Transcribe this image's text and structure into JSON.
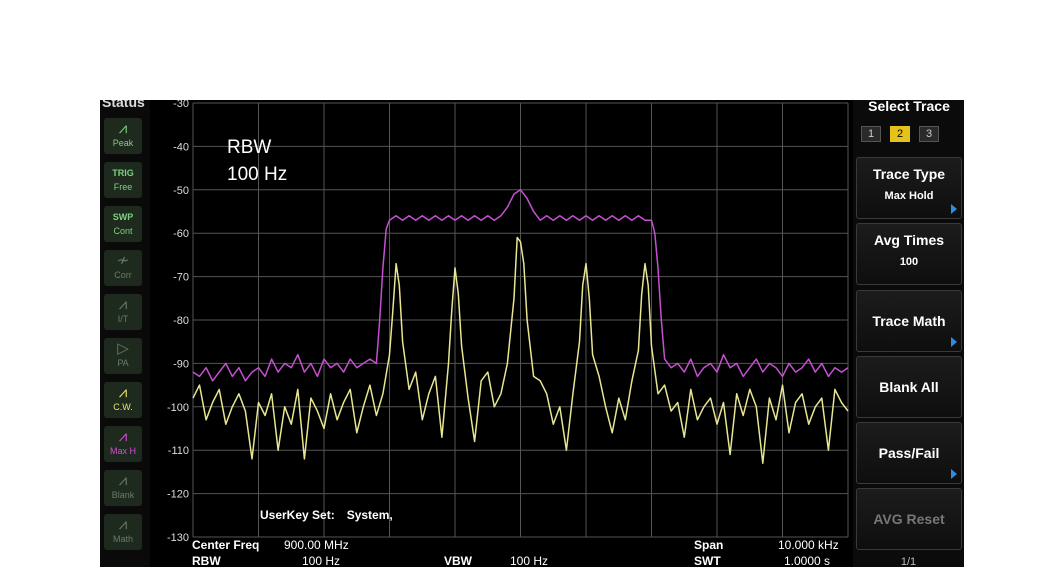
{
  "status_panel": {
    "title": "Status",
    "buttons": [
      {
        "label": "Peak",
        "icon": "peak-icon",
        "color": "#7fcf7f",
        "dim": false
      },
      {
        "label_top": "TRIG",
        "label": "Free",
        "icon": "trigger-icon",
        "color": "#7fcf7f",
        "dim": false
      },
      {
        "label_top": "SWP",
        "label": "Cont",
        "icon": "sweep-icon",
        "color": "#7fcf7f",
        "dim": false
      },
      {
        "label": "Corr",
        "icon": "correction-icon",
        "color": "#6a7a6a",
        "dim": true
      },
      {
        "label": "I/T",
        "icon": "impedance-icon",
        "color": "#6a7a6a",
        "dim": true
      },
      {
        "label": "PA",
        "icon": "preamp-icon",
        "color": "#6a7a6a",
        "dim": true
      },
      {
        "label": "C.W.",
        "icon": "clear-write-icon",
        "color": "#e8e46a",
        "dim": false
      },
      {
        "label": "Max H",
        "icon": "max-hold-icon",
        "color": "#d04fd4",
        "dim": false
      },
      {
        "label": "Blank",
        "icon": "blank-icon",
        "color": "#6a7a6a",
        "dim": true
      },
      {
        "label": "Math",
        "icon": "math-icon",
        "color": "#6a7a6a",
        "dim": true
      }
    ]
  },
  "annotation": {
    "line1": "RBW",
    "line2": "100 Hz"
  },
  "userkey": {
    "label": "UserKey Set:",
    "value": "System,"
  },
  "footer": {
    "center_freq_label": "Center Freq",
    "center_freq_value": "900.00 MHz",
    "span_label": "Span",
    "span_value": "10.000 kHz",
    "rbw_label": "RBW",
    "rbw_value": "100 Hz",
    "vbw_label": "VBW",
    "vbw_value": "100 Hz",
    "swt_label": "SWT",
    "swt_value": "1.0000 s"
  },
  "menu": {
    "title": "Select Trace",
    "traces": [
      "1",
      "2",
      "3"
    ],
    "active_trace": "2",
    "trace_type_label": "Trace Type",
    "trace_type_value": "Max Hold",
    "avg_times_label": "Avg Times",
    "avg_times_value": "100",
    "trace_math_label": "Trace Math",
    "blank_all_label": "Blank All",
    "pass_fail_label": "Pass/Fail",
    "avg_reset_label": "AVG Reset",
    "page_indicator": "1/1"
  },
  "chart_data": {
    "type": "line",
    "x_unit": "kHz offset from 900.00 MHz",
    "xlim": [
      -5,
      5
    ],
    "ylim": [
      -130,
      -30
    ],
    "y_ticks": [
      "-30",
      "-40",
      "-50",
      "-60",
      "-70",
      "-80",
      "-90",
      "-100",
      "-110",
      "-120",
      "-130"
    ],
    "grid": true,
    "series": [
      {
        "color": "#e8e690",
        "x": [
          -5.0,
          -4.9,
          -4.8,
          -4.7,
          -4.6,
          -4.5,
          -4.4,
          -4.3,
          -4.2,
          -4.1,
          -4.0,
          -3.9,
          -3.8,
          -3.7,
          -3.6,
          -3.5,
          -3.4,
          -3.3,
          -3.2,
          -3.1,
          -3.0,
          -2.9,
          -2.8,
          -2.7,
          -2.6,
          -2.5,
          -2.4,
          -2.3,
          -2.2,
          -2.1,
          -2.0,
          -1.95,
          -1.9,
          -1.85,
          -1.8,
          -1.7,
          -1.6,
          -1.5,
          -1.4,
          -1.3,
          -1.2,
          -1.1,
          -1.05,
          -1.0,
          -0.95,
          -0.9,
          -0.8,
          -0.7,
          -0.6,
          -0.5,
          -0.4,
          -0.3,
          -0.2,
          -0.1,
          -0.05,
          0.0,
          0.05,
          0.1,
          0.2,
          0.3,
          0.4,
          0.5,
          0.6,
          0.7,
          0.8,
          0.9,
          0.95,
          1.0,
          1.05,
          1.1,
          1.2,
          1.3,
          1.4,
          1.5,
          1.6,
          1.7,
          1.8,
          1.85,
          1.9,
          1.95,
          2.0,
          2.1,
          2.2,
          2.3,
          2.4,
          2.5,
          2.6,
          2.7,
          2.8,
          2.9,
          3.0,
          3.1,
          3.2,
          3.3,
          3.4,
          3.5,
          3.6,
          3.7,
          3.8,
          3.9,
          4.0,
          4.1,
          4.2,
          4.3,
          4.4,
          4.5,
          4.6,
          4.7,
          4.8,
          4.9,
          5.0
        ],
        "y": [
          -98,
          -95,
          -103,
          -99,
          -96,
          -104,
          -100,
          -97,
          -101,
          -112,
          -99,
          -102,
          -97,
          -110,
          -100,
          -104,
          -96,
          -112,
          -98,
          -101,
          -105,
          -97,
          -103,
          -99,
          -96,
          -106,
          -100,
          -95,
          -102,
          -97,
          -88,
          -78,
          -67,
          -72,
          -85,
          -96,
          -92,
          -103,
          -97,
          -93,
          -107,
          -90,
          -78,
          -68,
          -74,
          -86,
          -98,
          -108,
          -94,
          -92,
          -100,
          -97,
          -90,
          -75,
          -61,
          -62,
          -67,
          -80,
          -93,
          -94,
          -97,
          -104,
          -100,
          -110,
          -97,
          -85,
          -72,
          -67,
          -75,
          -88,
          -93,
          -100,
          -106,
          -98,
          -103,
          -94,
          -87,
          -74,
          -67,
          -72,
          -86,
          -97,
          -95,
          -101,
          -99,
          -107,
          -96,
          -103,
          -100,
          -98,
          -104,
          -99,
          -111,
          -97,
          -102,
          -96,
          -100,
          -113,
          -98,
          -103,
          -95,
          -106,
          -99,
          -97,
          -104,
          -100,
          -98,
          -110,
          -96,
          -99,
          -101
        ]
      },
      {
        "color": "#c551d1",
        "x": [
          -5.0,
          -4.9,
          -4.8,
          -4.7,
          -4.6,
          -4.5,
          -4.4,
          -4.3,
          -4.2,
          -4.1,
          -4.0,
          -3.9,
          -3.8,
          -3.7,
          -3.6,
          -3.5,
          -3.4,
          -3.3,
          -3.2,
          -3.1,
          -3.0,
          -2.9,
          -2.8,
          -2.7,
          -2.6,
          -2.5,
          -2.4,
          -2.3,
          -2.2,
          -2.15,
          -2.1,
          -2.05,
          -2.0,
          -1.9,
          -1.8,
          -1.7,
          -1.6,
          -1.5,
          -1.4,
          -1.3,
          -1.2,
          -1.1,
          -1.0,
          -0.9,
          -0.8,
          -0.7,
          -0.6,
          -0.5,
          -0.4,
          -0.3,
          -0.2,
          -0.1,
          0.0,
          0.1,
          0.2,
          0.3,
          0.4,
          0.5,
          0.6,
          0.7,
          0.8,
          0.9,
          1.0,
          1.1,
          1.2,
          1.3,
          1.4,
          1.5,
          1.6,
          1.7,
          1.8,
          1.9,
          2.0,
          2.05,
          2.1,
          2.15,
          2.2,
          2.3,
          2.4,
          2.5,
          2.6,
          2.7,
          2.8,
          2.9,
          3.0,
          3.1,
          3.2,
          3.3,
          3.4,
          3.5,
          3.6,
          3.7,
          3.8,
          3.9,
          4.0,
          4.1,
          4.2,
          4.3,
          4.4,
          4.5,
          4.6,
          4.7,
          4.8,
          4.9,
          5.0
        ],
        "y": [
          -92,
          -93,
          -91,
          -94,
          -92,
          -90,
          -93,
          -91,
          -94,
          -92,
          -91,
          -93,
          -89,
          -92,
          -90,
          -91,
          -88,
          -92,
          -90,
          -93,
          -89,
          -91,
          -90,
          -92,
          -89,
          -91,
          -90,
          -89,
          -90,
          -80,
          -68,
          -59,
          -57,
          -56,
          -57,
          -56,
          -57,
          -56,
          -57,
          -56,
          -57,
          -56,
          -57,
          -56,
          -57,
          -56,
          -57,
          -56,
          -57,
          -56,
          -54,
          -51,
          -50,
          -52,
          -55,
          -57,
          -56,
          -57,
          -56,
          -57,
          -56,
          -57,
          -56,
          -57,
          -56,
          -57,
          -56,
          -57,
          -56,
          -57,
          -56,
          -57,
          -57,
          -60,
          -68,
          -80,
          -89,
          -91,
          -90,
          -92,
          -89,
          -93,
          -91,
          -90,
          -92,
          -88,
          -91,
          -90,
          -93,
          -91,
          -89,
          -92,
          -90,
          -91,
          -93,
          -90,
          -92,
          -91,
          -89,
          -92,
          -90,
          -93,
          -91,
          -92,
          -91
        ]
      }
    ]
  }
}
